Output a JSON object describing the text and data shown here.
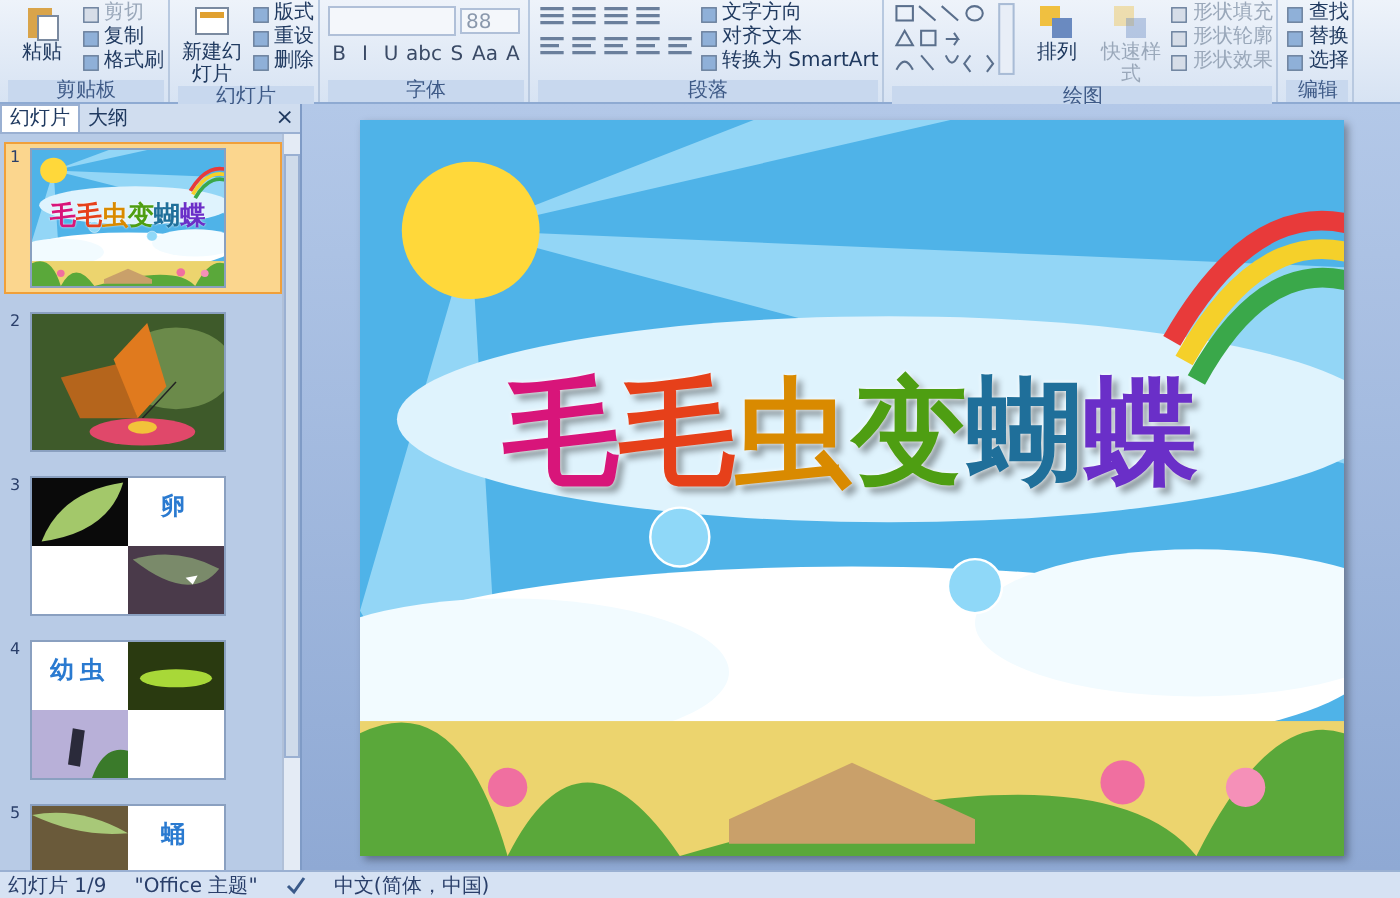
{
  "ribbon": {
    "groups": [
      {
        "kind": "clipboard",
        "label": "剪贴板",
        "large": [
          {
            "label": "粘贴",
            "disabled": false
          }
        ],
        "small": [
          {
            "label": "剪切",
            "disabled": true
          },
          {
            "label": "复制",
            "disabled": false
          },
          {
            "label": "格式刷",
            "disabled": false
          }
        ]
      },
      {
        "kind": "slides",
        "label": "幻灯片",
        "large": [
          {
            "label": "新建幻灯片",
            "disabled": false
          }
        ],
        "small": [
          {
            "label": "版式",
            "disabled": false
          },
          {
            "label": "重设",
            "disabled": false
          },
          {
            "label": "删除",
            "disabled": false
          }
        ]
      },
      {
        "kind": "font",
        "label": "字体",
        "font_size": "88",
        "tools": [
          "B",
          "I",
          "U",
          "abc",
          "S",
          "Aa",
          "A"
        ]
      },
      {
        "kind": "paragraph",
        "label": "段落",
        "small": [
          {
            "label": "文字方向",
            "disabled": false
          },
          {
            "label": "对齐文本",
            "disabled": false
          },
          {
            "label": "转换为 SmartArt",
            "disabled": false
          }
        ]
      },
      {
        "kind": "drawing",
        "label": "绘图",
        "large": [
          {
            "label": "排列",
            "disabled": false
          },
          {
            "label": "快速样式",
            "disabled": true
          }
        ],
        "small": [
          {
            "label": "形状填充",
            "disabled": true
          },
          {
            "label": "形状轮廓",
            "disabled": true
          },
          {
            "label": "形状效果",
            "disabled": true
          }
        ]
      },
      {
        "kind": "editing",
        "label": "编辑",
        "small": [
          {
            "label": "查找",
            "disabled": false
          },
          {
            "label": "替换",
            "disabled": false
          },
          {
            "label": "选择",
            "disabled": false
          }
        ]
      }
    ]
  },
  "panel": {
    "tabs": [
      {
        "label": "幻灯片",
        "selected": true
      },
      {
        "label": "大纲",
        "selected": false
      }
    ],
    "close": "×",
    "slides": [
      {
        "number": "1",
        "kind": "title",
        "title": "毛毛虫变蝴蝶",
        "selected": true
      },
      {
        "number": "2",
        "selected": false
      },
      {
        "number": "3",
        "kind": "text_photos",
        "text": "卵",
        "selected": false
      },
      {
        "number": "4",
        "kind": "text_photos",
        "text": "幼虫",
        "selected": false
      },
      {
        "number": "5",
        "kind": "text_photos",
        "text": "蛹",
        "selected": false
      }
    ]
  },
  "slide": {
    "title": "毛毛虫变蝴蝶"
  },
  "status_bar": {
    "slide": "幻灯片 1/9",
    "theme": "\"Office 主题\"",
    "language": "中文(简体，中国)"
  }
}
